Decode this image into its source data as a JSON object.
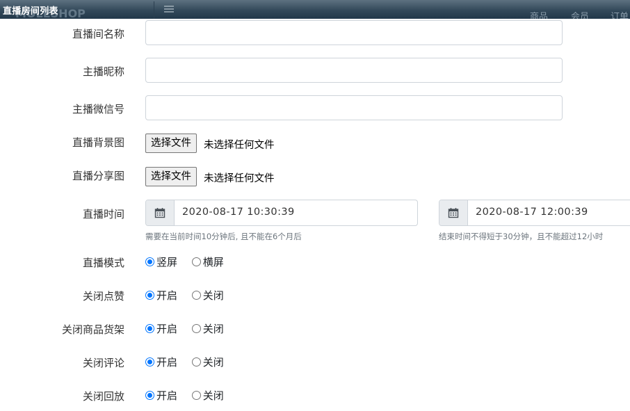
{
  "header": {
    "title": "直播房间列表",
    "ghost_logo": "MOLESHOP",
    "nav_items": [
      "商品",
      "会员",
      "订单"
    ]
  },
  "form": {
    "room_name": {
      "label": "直播间名称",
      "value": ""
    },
    "anchor_nickname": {
      "label": "主播昵称",
      "value": ""
    },
    "anchor_wechat": {
      "label": "主播微信号",
      "value": ""
    },
    "cover_image": {
      "label": "直播背景图",
      "button": "选择文件",
      "status": "未选择任何文件"
    },
    "share_image": {
      "label": "直播分享图",
      "button": "选择文件",
      "status": "未选择任何文件"
    },
    "live_time": {
      "label": "直播时间",
      "start": "2020-08-17 10:30:39",
      "start_hint": "需要在当前时间10分钟后, 且不能在6个月后",
      "end": "2020-08-17 12:00:39",
      "end_hint": "结束时间不得短于30分钟，且不能超过12小时"
    },
    "live_mode": {
      "label": "直播模式",
      "options": [
        "竖屏",
        "横屏"
      ],
      "selected": 0
    },
    "close_like": {
      "label": "关闭点赞",
      "options": [
        "开启",
        "关闭"
      ],
      "selected": 0
    },
    "close_goods_shelf": {
      "label": "关闭商品货架",
      "options": [
        "开启",
        "关闭"
      ],
      "selected": 0
    },
    "close_comment": {
      "label": "关闭评论",
      "options": [
        "开启",
        "关闭"
      ],
      "selected": 0
    },
    "close_replay": {
      "label": "关闭回放",
      "options": [
        "开启",
        "关闭"
      ],
      "selected": 0
    }
  },
  "colors": {
    "radio_accent": "#0075ff",
    "header_dark": "#22384a"
  },
  "icons": {
    "date_addon": "calendar-icon",
    "menu": "hamburger-icon"
  }
}
